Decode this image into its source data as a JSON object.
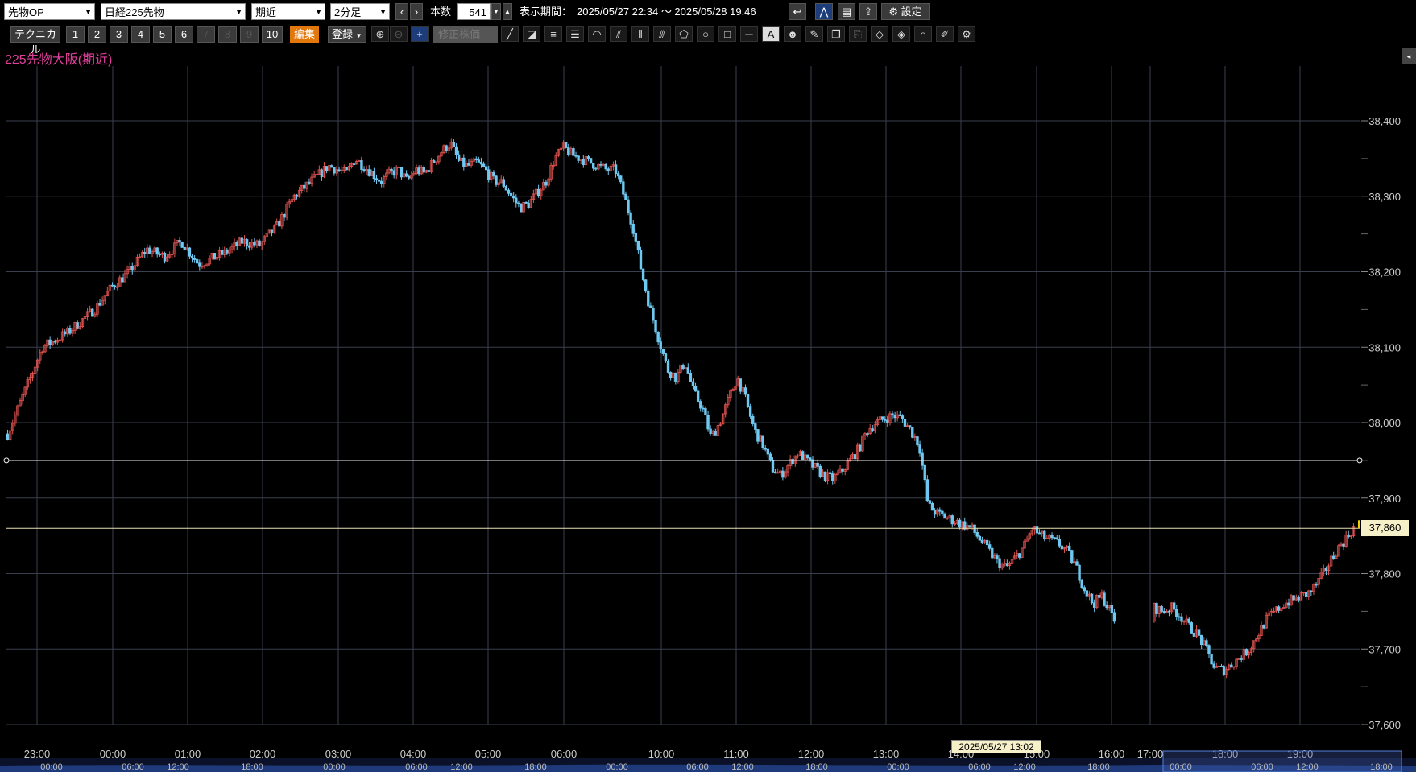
{
  "toolbar": {
    "product": "先物OP",
    "instrument": "日経225先物",
    "contract": "期近",
    "interval": "2分足",
    "count_label": "本数",
    "count_value": "541",
    "period_label": "表示期間：",
    "period_value": "2025/05/27 22:34 ～ 2025/05/28 19:46",
    "settings_label": "設定",
    "technical_label": "テクニカル",
    "presets": [
      "1",
      "2",
      "3",
      "4",
      "5",
      "6",
      "7",
      "8",
      "9",
      "10"
    ],
    "edit_label": "編集",
    "register_label": "登録",
    "adjusted_label": "修正株価"
  },
  "chart_title": "225先物大阪(期近)",
  "cursor_date": "2025/05/27 13:02",
  "last_price_label": "37,860",
  "colors": {
    "up": "#e0524f",
    "down": "#6ec8f0",
    "grid": "#3a3f4e",
    "title": "#e0409a"
  },
  "chart_data": {
    "type": "candlestick",
    "title": "225先物大阪(期近)",
    "interval": "2分足",
    "ylim": [
      37600,
      38420
    ],
    "y_ticks": [
      "38,400",
      "38,300",
      "38,200",
      "38,100",
      "38,000",
      "37,900",
      "37,800",
      "37,700",
      "37,600"
    ],
    "x_ticks": [
      "23:00",
      "00:00",
      "01:00",
      "02:00",
      "03:00",
      "04:00",
      "05:00",
      "06:00",
      "10:00",
      "11:00",
      "12:00",
      "13:00",
      "14:00",
      "15:00",
      "16:00",
      "17:00",
      "18:00",
      "19:00"
    ],
    "nav_ticks": [
      "00:00",
      "06:00",
      "12:00",
      "18:00",
      "00:00",
      "06:00",
      "12:00",
      "18:00",
      "00:00",
      "06:00",
      "12:00",
      "18:00",
      "00:00",
      "06:00",
      "12:00",
      "18:00",
      "00:00",
      "06:00",
      "12:00",
      "18:00"
    ],
    "h_lines": [
      37950,
      37860
    ],
    "last_price": 37860,
    "path": [
      [
        0,
        37985
      ],
      [
        4,
        38100
      ],
      [
        7,
        38120
      ],
      [
        10,
        38150
      ],
      [
        12,
        38180
      ],
      [
        14,
        38200
      ],
      [
        16,
        38230
      ],
      [
        18,
        38220
      ],
      [
        20,
        38240
      ],
      [
        22,
        38210
      ],
      [
        25,
        38225
      ],
      [
        27,
        38240
      ],
      [
        29,
        38235
      ],
      [
        31,
        38260
      ],
      [
        32,
        38280
      ],
      [
        33,
        38300
      ],
      [
        35,
        38320
      ],
      [
        37,
        38340
      ],
      [
        39,
        38330
      ],
      [
        40,
        38350
      ],
      [
        41,
        38340
      ],
      [
        43,
        38320
      ],
      [
        44,
        38330
      ],
      [
        45,
        38335
      ],
      [
        46,
        38320
      ],
      [
        47,
        38335
      ],
      [
        48,
        38330
      ],
      [
        50,
        38360
      ],
      [
        51,
        38370
      ],
      [
        52,
        38345
      ],
      [
        53,
        38340
      ],
      [
        54,
        38345
      ],
      [
        55,
        38335
      ],
      [
        56,
        38320
      ],
      [
        57,
        38318
      ],
      [
        58,
        38300
      ],
      [
        59,
        38285
      ],
      [
        60,
        38290
      ],
      [
        61,
        38305
      ],
      [
        62,
        38320
      ],
      [
        63,
        38350
      ],
      [
        64,
        38365
      ],
      [
        65,
        38355
      ],
      [
        66,
        38350
      ],
      [
        67,
        38345
      ],
      [
        68,
        38340
      ],
      [
        69,
        38335
      ],
      [
        70,
        38335
      ],
      [
        71,
        38300
      ],
      [
        72,
        38260
      ],
      [
        73,
        38200
      ],
      [
        74,
        38150
      ],
      [
        75,
        38110
      ],
      [
        76,
        38070
      ],
      [
        77,
        38060
      ],
      [
        78,
        38080
      ],
      [
        79,
        38040
      ],
      [
        80,
        38020
      ],
      [
        81,
        37980
      ],
      [
        82,
        38000
      ],
      [
        83,
        38030
      ],
      [
        84,
        38060
      ],
      [
        85,
        38030
      ],
      [
        86,
        37990
      ],
      [
        87,
        37970
      ],
      [
        88,
        37940
      ],
      [
        89,
        37930
      ],
      [
        90,
        37945
      ],
      [
        91,
        37960
      ],
      [
        92,
        37950
      ],
      [
        93,
        37940
      ],
      [
        94,
        37930
      ],
      [
        95,
        37925
      ],
      [
        96,
        37935
      ],
      [
        97,
        37950
      ],
      [
        98,
        37965
      ],
      [
        99,
        37990
      ],
      [
        100,
        38000
      ],
      [
        101,
        38005
      ],
      [
        102,
        38010
      ],
      [
        103,
        38005
      ],
      [
        104,
        37990
      ],
      [
        105,
        37970
      ],
      [
        106,
        37890
      ],
      [
        107,
        37880
      ],
      [
        108,
        37875
      ],
      [
        109,
        37870
      ],
      [
        110,
        37865
      ],
      [
        111,
        37860
      ],
      [
        112,
        37845
      ],
      [
        113,
        37830
      ],
      [
        114,
        37815
      ],
      [
        115,
        37808
      ],
      [
        116,
        37820
      ],
      [
        117,
        37835
      ],
      [
        118,
        37860
      ],
      [
        119,
        37850
      ],
      [
        120,
        37845
      ],
      [
        121,
        37840
      ],
      [
        122,
        37830
      ],
      [
        123,
        37810
      ],
      [
        124,
        37780
      ],
      [
        125,
        37760
      ],
      [
        126,
        37770
      ],
      [
        127,
        37750
      ],
      [
        128,
        37725
      ],
      [
        129,
        37720
      ],
      [
        130,
        37715
      ],
      [
        131,
        37720
      ],
      [
        132,
        37755
      ],
      [
        133,
        37750
      ],
      [
        134,
        37755
      ],
      [
        135,
        37745
      ],
      [
        136,
        37730
      ],
      [
        137,
        37720
      ],
      [
        138,
        37700
      ],
      [
        139,
        37675
      ],
      [
        140,
        37672
      ],
      [
        141,
        37680
      ],
      [
        142,
        37690
      ],
      [
        143,
        37700
      ],
      [
        144,
        37720
      ],
      [
        145,
        37740
      ],
      [
        146,
        37750
      ],
      [
        147,
        37760
      ],
      [
        148,
        37765
      ],
      [
        149,
        37770
      ],
      [
        150,
        37775
      ],
      [
        151,
        37790
      ],
      [
        152,
        37810
      ],
      [
        153,
        37830
      ],
      [
        154,
        37845
      ],
      [
        155,
        37860
      ]
    ],
    "session_gaps": [
      [
        71,
        0.0
      ],
      [
        130,
        0.0
      ]
    ]
  }
}
